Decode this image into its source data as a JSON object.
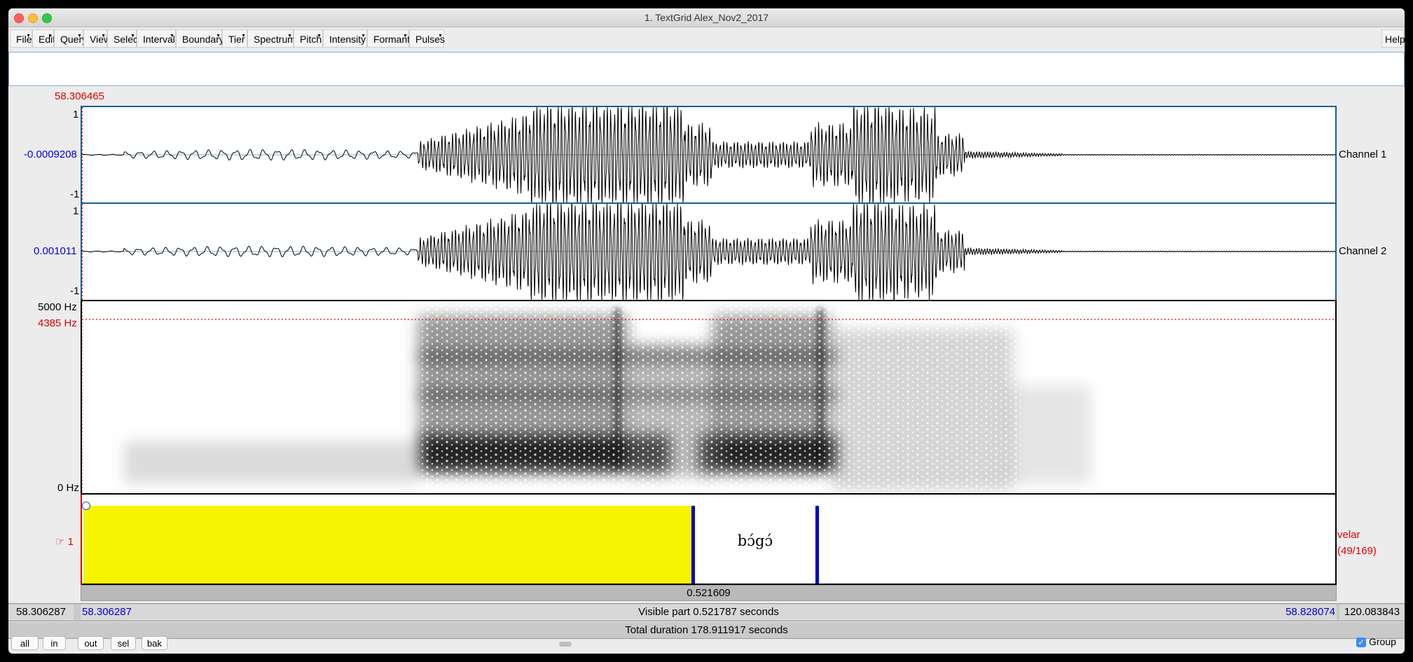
{
  "window": {
    "title": "1. TextGrid Alex_Nov2_2017"
  },
  "menu": [
    "File",
    "Edit",
    "Query",
    "View",
    "Select",
    "Interval",
    "Boundary",
    "Tier",
    "Spectrum",
    "Pitch",
    "Intensity",
    "Formant",
    "Pulses"
  ],
  "help_label": "Help",
  "cursor_time": "58.306465",
  "channels": [
    {
      "name": "Channel 1",
      "ymax": "1",
      "ymin": "-1",
      "cursor_value": "-0.0009208"
    },
    {
      "name": "Channel 2",
      "ymax": "1",
      "ymin": "-1",
      "cursor_value": "0.001011"
    }
  ],
  "spectrogram": {
    "top_label": "5000 Hz",
    "cursor_freq": "4385 Hz",
    "bottom_label": "0 Hz"
  },
  "tier": {
    "number": "1",
    "name": "velar",
    "count": "(49/169)",
    "interval_text": "bɔ́gɔ́"
  },
  "selection_duration": "0.521609",
  "time_bar": {
    "left_outer": "58.306287",
    "left_visible": "58.306287",
    "visible_part": "Visible part 0.521787 seconds",
    "right_visible": "58.828074",
    "right_outer": "120.083843"
  },
  "total_duration": "Total duration 178.911917 seconds",
  "buttons": {
    "all": "all",
    "in": "in",
    "out": "out",
    "sel": "sel",
    "bak": "bak"
  },
  "group": {
    "label": "Group",
    "checked": true
  },
  "colors": {
    "selection": "#f7f400",
    "boundary": "#0000cc",
    "cursor": "#e00000",
    "panel_border": "#1a5f93"
  }
}
